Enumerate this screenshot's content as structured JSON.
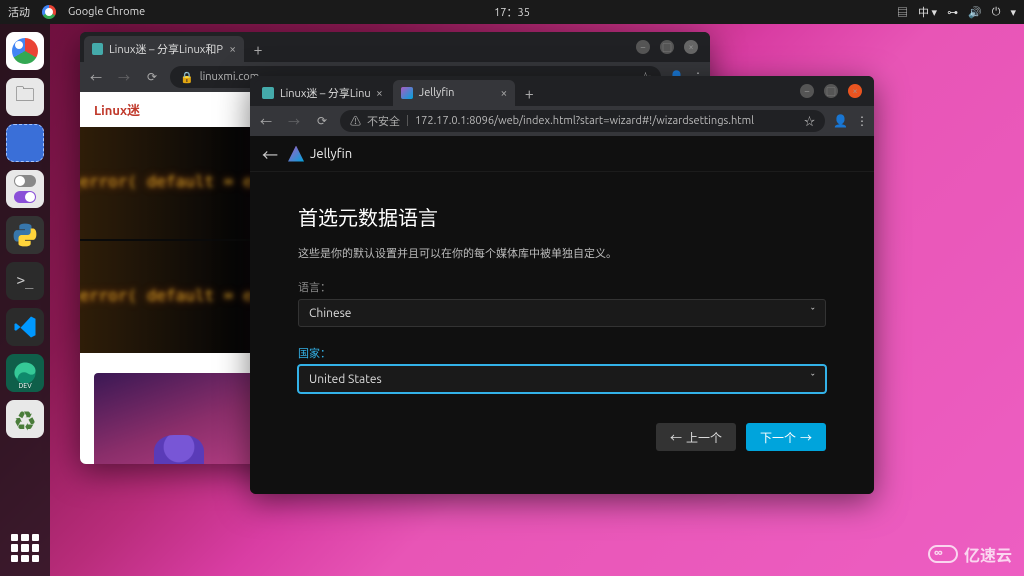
{
  "panel": {
    "activities": "活动",
    "app": "Google Chrome",
    "time": "17：35",
    "ime": "中 ▾"
  },
  "dock": {
    "edge_badge": "DEV"
  },
  "win1": {
    "tab_title": "Linux迷 – 分享Linux和Pyt",
    "address": "linuxmi.com",
    "brand": "Linux迷"
  },
  "win2": {
    "tab1_title": "Linux迷 – 分享Linux和Pyt",
    "tab2_title": "Jellyfin",
    "addr_warn": "不安全",
    "address": "172.17.0.1:8096/web/index.html?start=wizard#!/wizardsettings.html",
    "jf_brand": "Jellyfin",
    "heading": "首选元数据语言",
    "description": "这些是你的默认设置并且可以在你的每个媒体库中被单独自定义。",
    "lang_label": "语言：",
    "lang_value": "Chinese",
    "country_label": "国家：",
    "country_value": "United States",
    "prev": "上一个",
    "next": "下一个"
  },
  "watermark": "亿速云"
}
